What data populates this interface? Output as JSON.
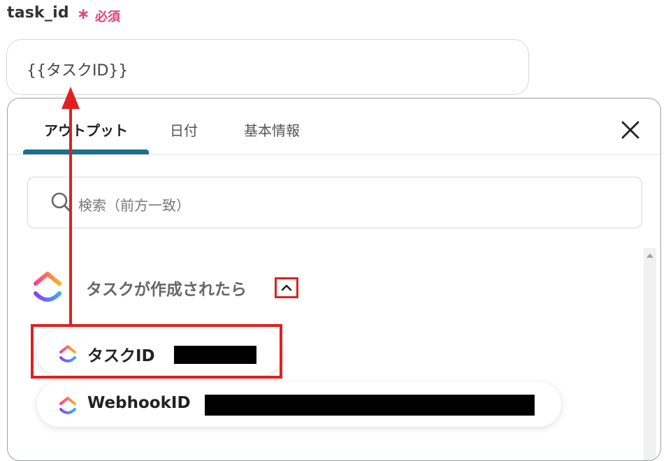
{
  "field": {
    "label": "task_id",
    "required_mark": "∗",
    "required_text": "必須",
    "value": "{{タスクID}}"
  },
  "tabs": [
    {
      "label": "アウトプット",
      "active": true
    },
    {
      "label": "日付",
      "active": false
    },
    {
      "label": "基本情報",
      "active": false
    }
  ],
  "search": {
    "placeholder": "検索（前方一致）"
  },
  "group": {
    "title": "タスクが作成されたら",
    "icon": "clickup-logo-icon",
    "toggle_icon": "chevron-up-icon",
    "items": [
      {
        "label": "タスクID"
      },
      {
        "label": "WebhookID"
      }
    ]
  },
  "colors": {
    "required": "#e0457b",
    "tab_underline": "#1e6f8a",
    "annotation": "#e02020"
  },
  "icons": {
    "close": "close-icon",
    "search": "search-icon"
  }
}
